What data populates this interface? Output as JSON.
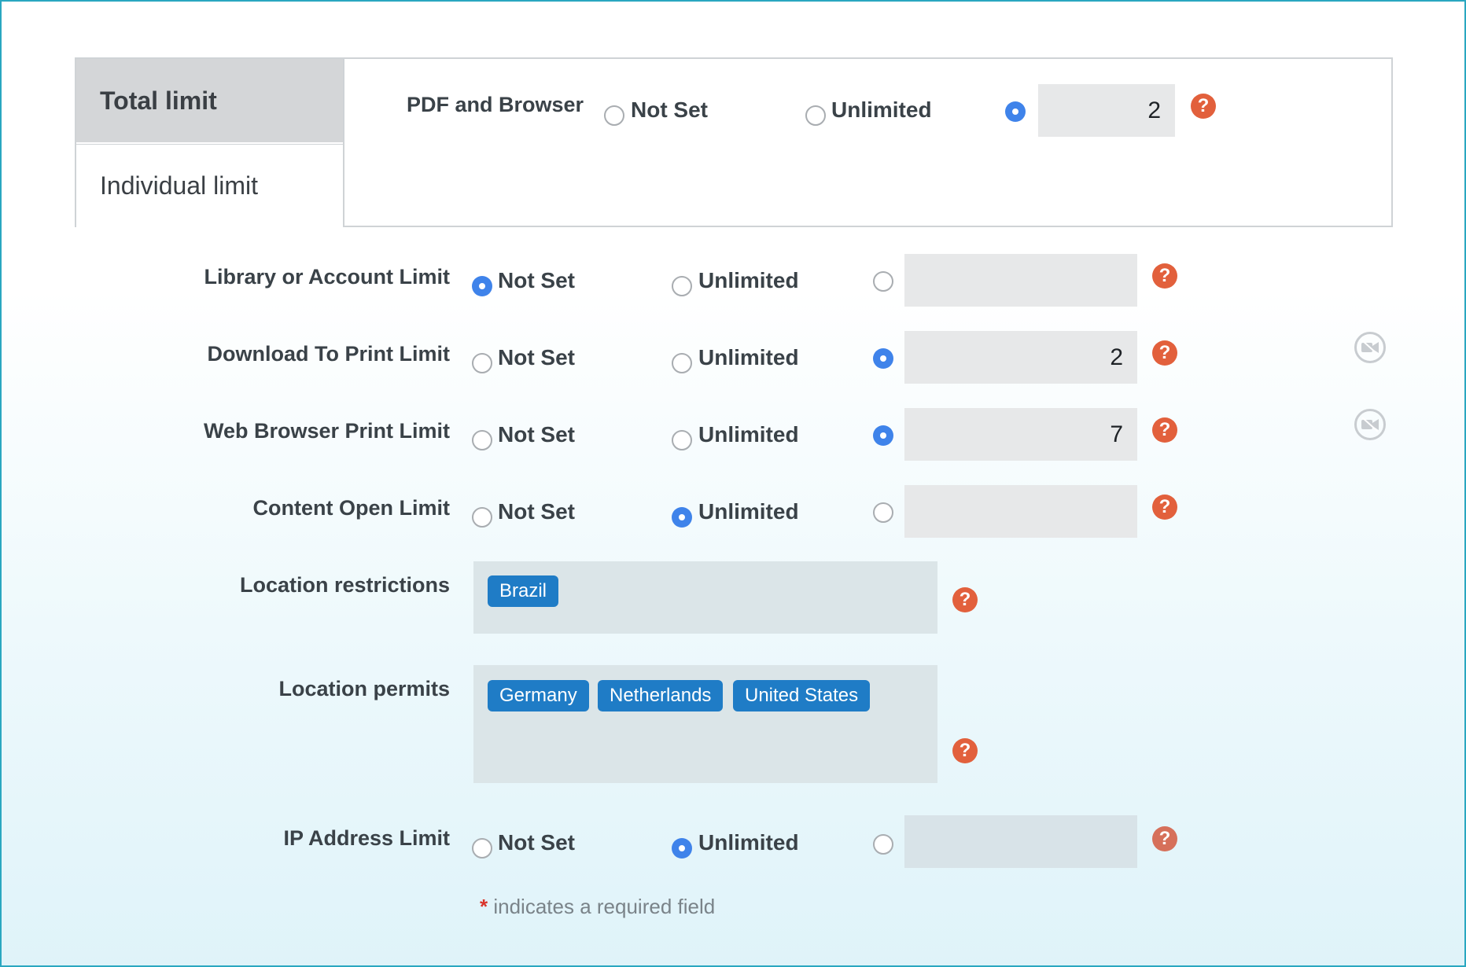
{
  "tabs": [
    {
      "label": "Total limit",
      "active": true
    },
    {
      "label": "Individual limit",
      "active": false
    }
  ],
  "total_row": {
    "label": "PDF and Browser",
    "options": [
      "Not Set",
      "Unlimited"
    ],
    "selected": "custom",
    "value": "2"
  },
  "rows": [
    {
      "label": "Library or Account Limit",
      "options": [
        "Not Set",
        "Unlimited"
      ],
      "selected": "Not Set",
      "value": ""
    },
    {
      "label": "Download To Print Limit",
      "options": [
        "Not Set",
        "Unlimited"
      ],
      "selected": "custom",
      "value": "2"
    },
    {
      "label": "Web Browser Print Limit",
      "options": [
        "Not Set",
        "Unlimited"
      ],
      "selected": "custom",
      "value": "7"
    },
    {
      "label": "Content Open Limit",
      "options": [
        "Not Set",
        "Unlimited"
      ],
      "selected": "Unlimited",
      "value": ""
    }
  ],
  "location_restrictions": {
    "label": "Location restrictions",
    "tags": [
      "Brazil"
    ]
  },
  "location_permits": {
    "label": "Location permits",
    "tags": [
      "Germany",
      "Netherlands",
      "United States"
    ]
  },
  "ip_row": {
    "label": "IP Address Limit",
    "options": [
      "Not Set",
      "Unlimited"
    ],
    "selected": "Unlimited",
    "value": ""
  },
  "help_glyph": "?",
  "icons": {
    "help": "question-circle-icon",
    "camera": "video-off-icon"
  },
  "footer": {
    "asterisk": "*",
    "note": "indicates a required field"
  },
  "colors": {
    "accent": "#3f83ea",
    "help": "#e2603c",
    "tag": "#1f7cc6",
    "required": "#d9342b"
  }
}
